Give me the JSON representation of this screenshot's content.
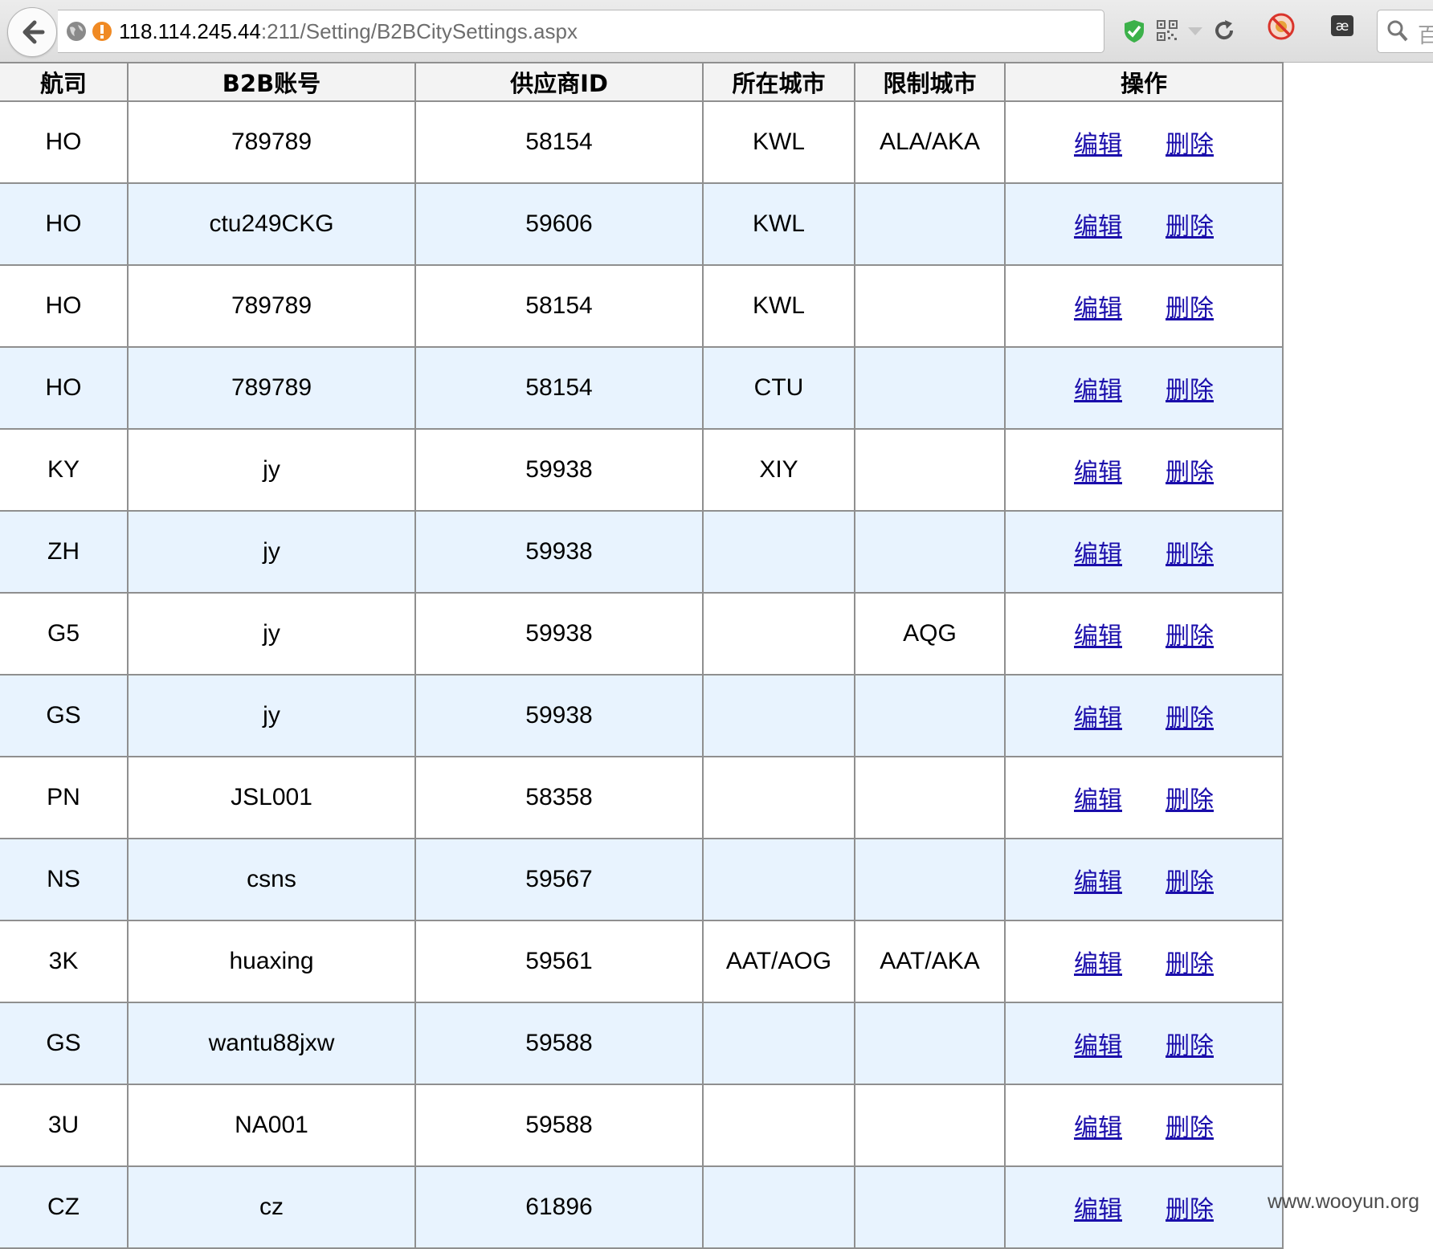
{
  "browser": {
    "url_host": "118.114.245.44",
    "url_rest": ":211/Setting/B2BCitySettings.aspx",
    "search_text": "百"
  },
  "table": {
    "headers": [
      "航司",
      "B2B账号",
      "供应商ID",
      "所在城市",
      "限制城市",
      "操作"
    ],
    "action_edit": "编辑",
    "action_delete": "删除",
    "rows": [
      [
        "HO",
        "789789",
        "58154",
        "KWL",
        "ALA/AKA"
      ],
      [
        "HO",
        "ctu249CKG",
        "59606",
        "KWL",
        ""
      ],
      [
        "HO",
        "789789",
        "58154",
        "KWL",
        ""
      ],
      [
        "HO",
        "789789",
        "58154",
        "CTU",
        ""
      ],
      [
        "KY",
        "jy",
        "59938",
        "XIY",
        ""
      ],
      [
        "ZH",
        "jy",
        "59938",
        "",
        ""
      ],
      [
        "G5",
        "jy",
        "59938",
        "",
        "AQG"
      ],
      [
        "GS",
        "jy",
        "59938",
        "",
        ""
      ],
      [
        "PN",
        "JSL001",
        "58358",
        "",
        ""
      ],
      [
        "NS",
        "csns",
        "59567",
        "",
        ""
      ],
      [
        "3K",
        "huaxing",
        "59561",
        "AAT/AOG",
        "AAT/AKA"
      ],
      [
        "GS",
        "wantu88jxw",
        "59588",
        "",
        ""
      ],
      [
        "3U",
        "NA001",
        "59588",
        "",
        ""
      ],
      [
        "CZ",
        "cz",
        "61896",
        "",
        ""
      ]
    ]
  },
  "watermark": "www.wooyun.org",
  "colors": {
    "row_alt": "#e8f3fe",
    "link": "#1a0dab",
    "border": "#8f8f8f"
  }
}
